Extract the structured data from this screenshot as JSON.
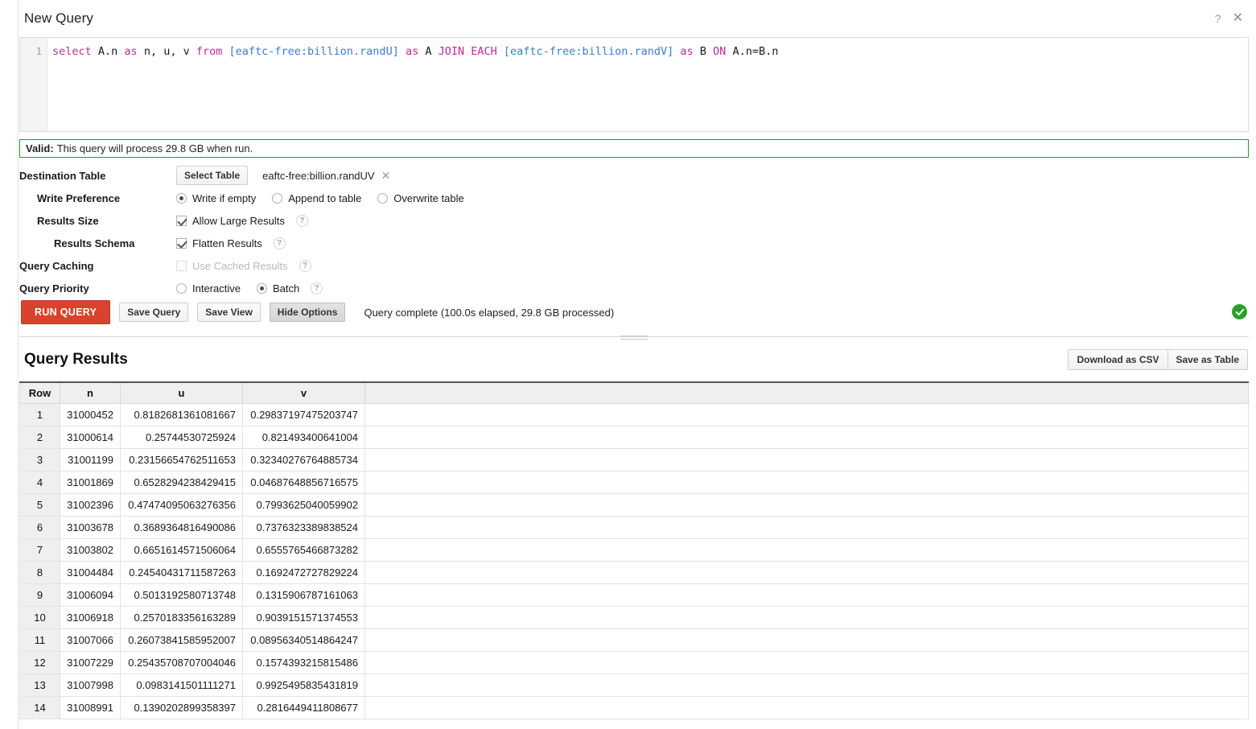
{
  "window": {
    "title": "New Query",
    "help_icon": "question-mark-icon",
    "close_icon": "close-icon"
  },
  "editor": {
    "line_number": "1",
    "query_tokens": [
      {
        "text": "select",
        "type": "keyword"
      },
      {
        "text": " A.n ",
        "type": "plain"
      },
      {
        "text": "as",
        "type": "keyword"
      },
      {
        "text": " n, u, v ",
        "type": "plain"
      },
      {
        "text": "from",
        "type": "keyword"
      },
      {
        "text": " ",
        "type": "plain"
      },
      {
        "text": "[eaftc-free:billion.randU]",
        "type": "table"
      },
      {
        "text": " ",
        "type": "plain"
      },
      {
        "text": "as",
        "type": "keyword"
      },
      {
        "text": " A ",
        "type": "plain"
      },
      {
        "text": "JOIN EACH",
        "type": "keyword"
      },
      {
        "text": " ",
        "type": "plain"
      },
      {
        "text": "[eaftc-free:billion.randV]",
        "type": "table"
      },
      {
        "text": " ",
        "type": "plain"
      },
      {
        "text": "as",
        "type": "keyword"
      },
      {
        "text": " B ",
        "type": "plain"
      },
      {
        "text": "ON",
        "type": "keyword"
      },
      {
        "text": " A.n=B.n",
        "type": "plain"
      }
    ],
    "query_plain": "select A.n as n, u, v from [eaftc-free:billion.randU] as A JOIN EACH [eaftc-free:billion.randV] as B ON A.n=B.n"
  },
  "validation": {
    "prefix": "Valid:",
    "message": "This query will process 29.8 GB when run.",
    "border_color": "#2a9a2a"
  },
  "options": {
    "destination_table": {
      "label": "Destination Table",
      "select_button": "Select Table",
      "value": "eaftc-free:billion.randUV",
      "clear_icon": "close-icon"
    },
    "write_preference": {
      "label": "Write Preference",
      "choices": [
        {
          "label": "Write if empty",
          "selected": true
        },
        {
          "label": "Append to table",
          "selected": false
        },
        {
          "label": "Overwrite table",
          "selected": false
        }
      ]
    },
    "results_size": {
      "label": "Results Size",
      "checkbox_label": "Allow Large Results",
      "checked": true,
      "help": "?"
    },
    "results_schema": {
      "label": "Results Schema",
      "checkbox_label": "Flatten Results",
      "checked": true,
      "help": "?"
    },
    "query_caching": {
      "label": "Query Caching",
      "checkbox_label": "Use Cached Results",
      "checked": false,
      "disabled": true,
      "help": "?"
    },
    "query_priority": {
      "label": "Query Priority",
      "choices": [
        {
          "label": "Interactive",
          "selected": false
        },
        {
          "label": "Batch",
          "selected": true
        }
      ],
      "help": "?"
    }
  },
  "actions": {
    "run_query": "RUN QUERY",
    "save_query": "Save Query",
    "save_view": "Save View",
    "hide_options": "Hide Options",
    "status": "Query complete (100.0s elapsed, 29.8 GB processed)",
    "status_icon": "success-check-icon",
    "status_color": "#2aa02a"
  },
  "results": {
    "title": "Query Results",
    "download_csv": "Download as CSV",
    "save_as_table": "Save as Table",
    "columns": [
      "Row",
      "n",
      "u",
      "v"
    ],
    "rows": [
      [
        "1",
        "31000452",
        "0.8182681361081667",
        "0.29837197475203747"
      ],
      [
        "2",
        "31000614",
        "0.25744530725924",
        "0.821493400641004"
      ],
      [
        "3",
        "31001199",
        "0.23156654762511653",
        "0.32340276764885734"
      ],
      [
        "4",
        "31001869",
        "0.6528294238429415",
        "0.04687648856716575"
      ],
      [
        "5",
        "31002396",
        "0.47474095063276356",
        "0.7993625040059902"
      ],
      [
        "6",
        "31003678",
        "0.3689364816490086",
        "0.7376323389838524"
      ],
      [
        "7",
        "31003802",
        "0.6651614571506064",
        "0.6555765466873282"
      ],
      [
        "8",
        "31004484",
        "0.24540431711587263",
        "0.1692472727829224"
      ],
      [
        "9",
        "31006094",
        "0.5013192580713748",
        "0.1315906787161063"
      ],
      [
        "10",
        "31006918",
        "0.2570183356163289",
        "0.9039151571374553"
      ],
      [
        "11",
        "31007066",
        "0.26073841585952007",
        "0.08956340514864247"
      ],
      [
        "12",
        "31007229",
        "0.25435708707004046",
        "0.1574393215815486"
      ],
      [
        "13",
        "31007998",
        "0.0983141501111271",
        "0.9925495835431819"
      ],
      [
        "14",
        "31008991",
        "0.1390202899358397",
        "0.2816449411808677"
      ]
    ]
  }
}
